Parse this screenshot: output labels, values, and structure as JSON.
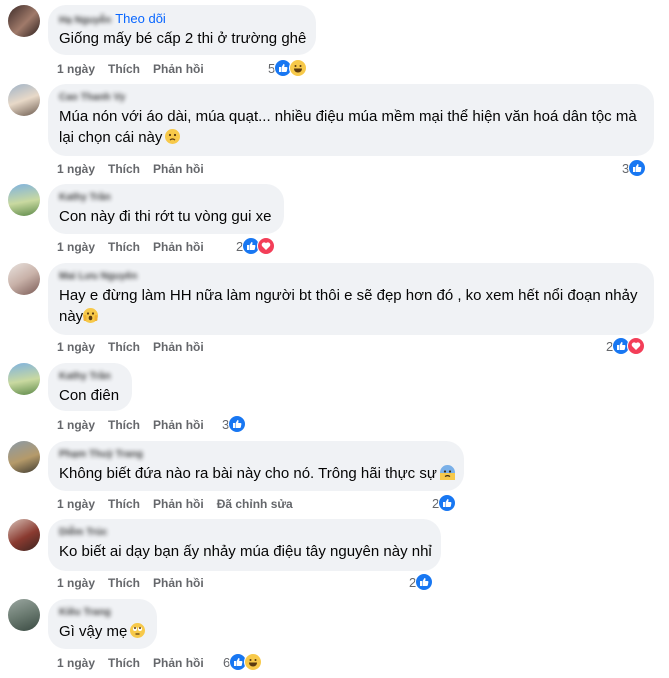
{
  "comments": [
    {
      "author": "Hạ Nguyễn",
      "follow": "Theo dõi",
      "lines": [
        "Giống mấy bé cấp 2 thi ở trường ghê"
      ],
      "time": "1 ngày",
      "like": "Thích",
      "reply": "Phản hồi",
      "count": "5",
      "reactions": [
        "like",
        "haha"
      ]
    },
    {
      "author": "Cao Thanh Vy",
      "lines": [
        "Múa nón với áo dài, múa quạt... nhiều điệu múa mềm mại thể hiện văn hoá dân tộc mà",
        "lại chọn cái này"
      ],
      "emoji_after": "confused-face",
      "time": "1 ngày",
      "like": "Thích",
      "reply": "Phản hồi",
      "count": "3",
      "reactions": [
        "like"
      ]
    },
    {
      "author": "Kathy Trần",
      "lines": [
        "Con này đi thi rớt tu vòng gui xe"
      ],
      "time": "1 ngày",
      "like": "Thích",
      "reply": "Phản hồi",
      "count": "2",
      "reactions": [
        "like",
        "love"
      ]
    },
    {
      "author": "Mai Lưu Nguyên",
      "lines": [
        "Hay e đừng làm HH nữa làm người bt thôi e sẽ đẹp hơn đó , ko xem hết nổi đoạn nhảy",
        "này"
      ],
      "emoji_after": "shocked-face",
      "time": "1 ngày",
      "like": "Thích",
      "reply": "Phản hồi",
      "count": "2",
      "reactions": [
        "like",
        "love"
      ]
    },
    {
      "author": "Kathy Trần",
      "lines": [
        "Con điên"
      ],
      "time": "1 ngày",
      "like": "Thích",
      "reply": "Phản hồi",
      "count": "3",
      "reactions": [
        "like"
      ]
    },
    {
      "author": "Phạm Thuỳ Trang",
      "lines": [
        "Không biết đứa nào ra bài này cho nó. Trông hãi thực sự"
      ],
      "emoji_after": "anxious-face",
      "time": "1 ngày",
      "like": "Thích",
      "reply": "Phản hồi",
      "edited": "Đã chỉnh sửa",
      "count": "2",
      "reactions": [
        "like"
      ]
    },
    {
      "author": "Diễm Trúc",
      "lines": [
        "Ko biết ai dạy bạn ấy nhảy múa điệu tây nguyên này nhỉ"
      ],
      "time": "1 ngày",
      "like": "Thích",
      "reply": "Phản hồi",
      "count": "2",
      "reactions": [
        "like"
      ]
    },
    {
      "author": "Kiều Trang",
      "lines": [
        "Gì vậy mẹ"
      ],
      "emoji_after": "eye-roll-face",
      "time": "1 ngày",
      "like": "Thích",
      "reply": "Phản hồi",
      "count": "6",
      "reactions": [
        "like",
        "haha"
      ]
    }
  ],
  "colors": {
    "bubble": "#f0f2f5",
    "like": "#1877f2",
    "love": "#f33e58",
    "haha": "#f7c94a",
    "follow": "#0866ff",
    "meta": "#65676b"
  }
}
